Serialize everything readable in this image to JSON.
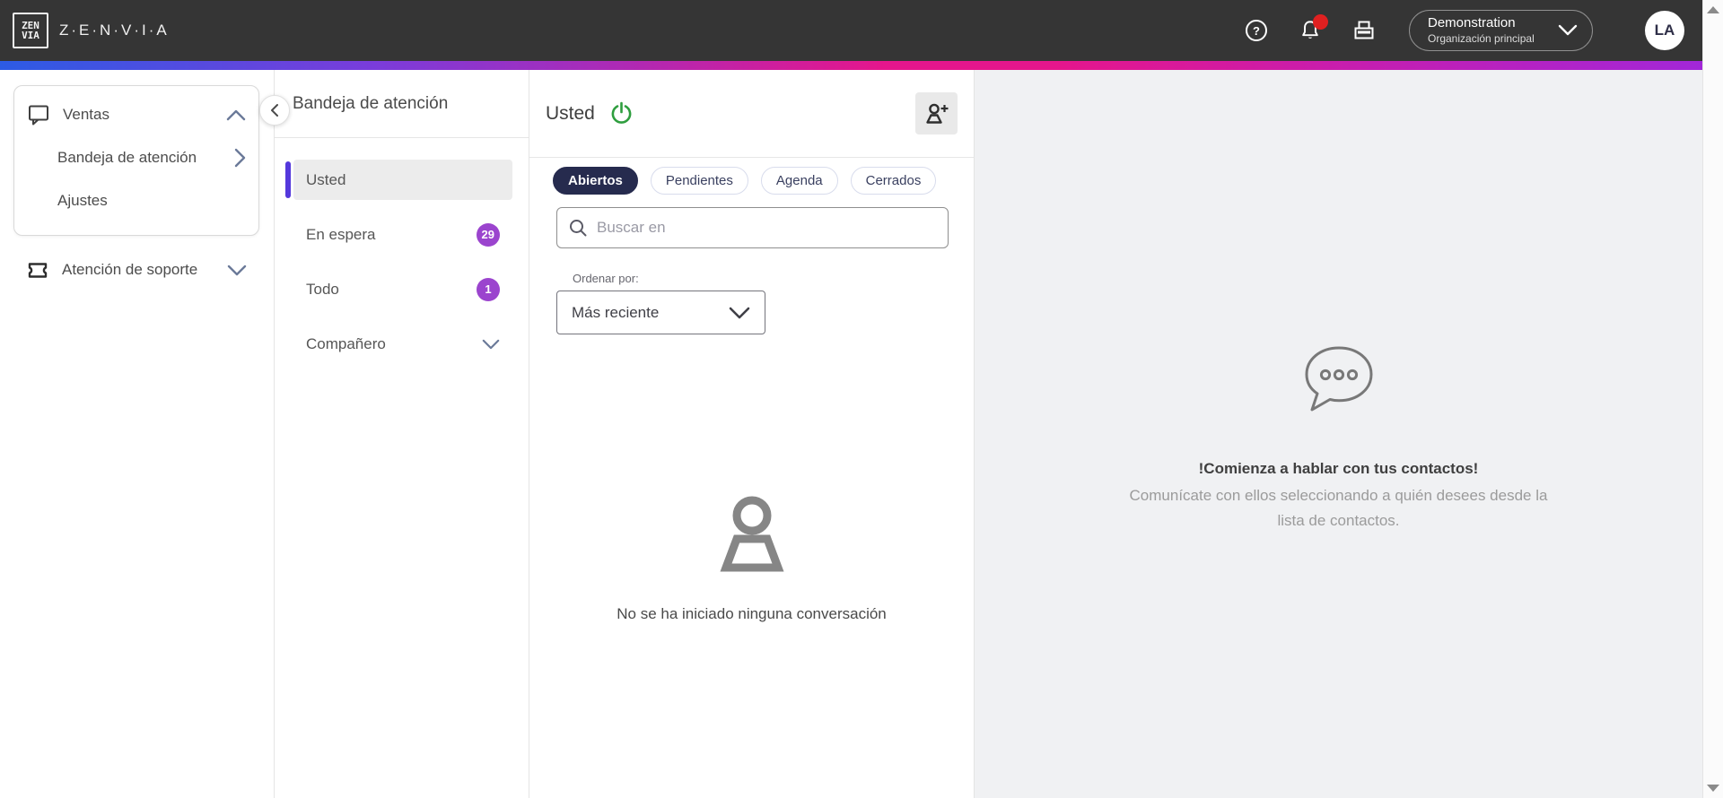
{
  "topbar": {
    "brand": "Z·E·N·V·I·A",
    "help_label": "?",
    "org": {
      "primary": "Demonstration",
      "secondary": "Organización principal"
    },
    "avatar": "LA"
  },
  "sidebar": {
    "ventas": {
      "label": "Ventas",
      "children": [
        {
          "label": "Bandeja de atención"
        },
        {
          "label": "Ajustes"
        }
      ]
    },
    "support": {
      "label": "Atención de soporte"
    }
  },
  "inbox": {
    "title": "Bandeja de atención",
    "items": [
      {
        "label": "Usted",
        "selected": true
      },
      {
        "label": "En espera",
        "badge": "29"
      },
      {
        "label": "Todo",
        "badge": "1"
      },
      {
        "label": "Compañero",
        "expandable": true
      }
    ]
  },
  "conversations": {
    "title": "Usted",
    "tabs": [
      {
        "label": "Abiertos",
        "active": true
      },
      {
        "label": "Pendientes"
      },
      {
        "label": "Agenda"
      },
      {
        "label": "Cerrados"
      }
    ],
    "search_placeholder": "Buscar en",
    "sort_label": "Ordenar por:",
    "sort_value": "Más reciente",
    "empty_text": "No se ha iniciado ninguna conversación"
  },
  "chat_area": {
    "title": "!Comienza a hablar con tus contactos!",
    "subtitle": "Comunícate con ellos seleccionando a quién desees desde la lista de contactos."
  },
  "colors": {
    "topbar_bg": "#353535",
    "accent_indigo": "#5438dc",
    "badge_purple": "#9b44ce",
    "tab_active_navy": "#262b4e",
    "power_green": "#2f9e3f",
    "notification_red": "#e02020",
    "chat_panel_bg": "#f0f1f3",
    "gradient": [
      "#2c5be4",
      "#7a3cdb",
      "#e5168c",
      "#a227d8"
    ]
  }
}
